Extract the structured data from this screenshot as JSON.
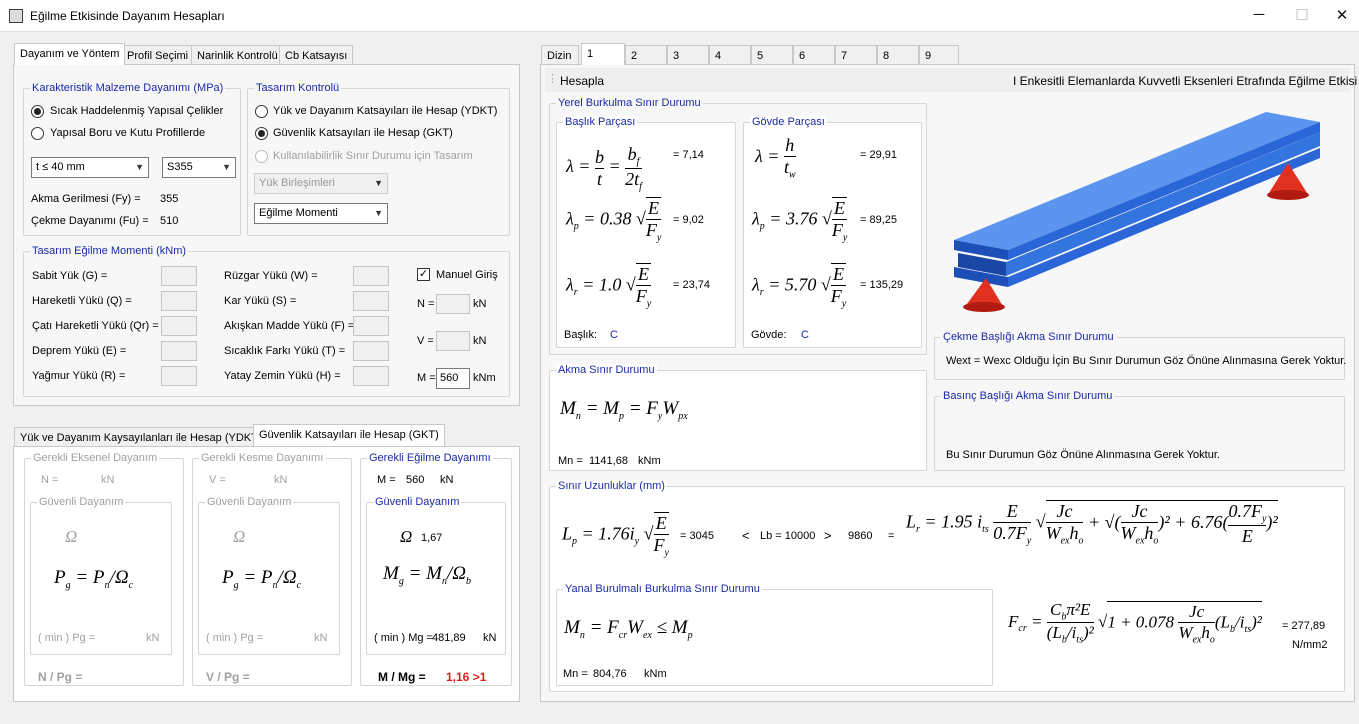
{
  "window": {
    "title": "Eğilme Etkisinde Dayanım Hesapları"
  },
  "left_tabs": [
    "Dayanım ve Yöntem",
    "Profil Seçimi",
    "Narinlik Kontrolü",
    "Cb Katsayısı"
  ],
  "material": {
    "legend": "Karakteristik Malzeme Dayanımı (MPa)",
    "opt1": "Sıcak Haddelenmiş Yapısal Çelikler",
    "opt2": "Yapısal Boru ve Kutu Profillerde",
    "thickness": "t ≤ 40 mm",
    "grade": "S355",
    "fy_label": "Akma Gerilmesi (Fy) =",
    "fy": "355",
    "fu_label": "Çekme Dayanımı (Fu) =",
    "fu": "510"
  },
  "design": {
    "legend": "Tasarım Kontrolü",
    "opt1": "Yük ve Dayanım Katsayıları ile Hesap (YDKT)",
    "opt2": "Güvenlik Katsayıları ile Hesap (GKT)",
    "opt3": "Kullanılabilirlik Sınır Durumu için Tasarım",
    "combo": "Yük Birleşimleri",
    "moment": "Eğilme Momenti"
  },
  "moments": {
    "legend": "Tasarım Eğilme Momenti (kNm)",
    "g": "Sabit Yük (G) =",
    "q": "Hareketli Yükü (Q) =",
    "qr": "Çatı Hareketli Yükü (Qr) =",
    "e": "Deprem Yükü (E) =",
    "r": "Yağmur Yükü (R) =",
    "w": "Rüzgar Yükü (W) =",
    "s": "Kar Yükü (S) =",
    "f": "Akışkan Madde Yükü (F) =",
    "t": "Sıcaklık Farkı Yükü (T) =",
    "h": "Yatay Zemin Yükü (H) =",
    "manual": "Manuel Giriş",
    "n_label": "N =",
    "v_label": "V =",
    "m_label": "M =",
    "unit_kn": "kN",
    "unit_knm": "kNm",
    "m_value": "560"
  },
  "result_tabs": [
    "Yük ve Dayanım Kaysayılanları ile Hesap (YDKT)",
    "Güvenlik Katsayıları ile Hesap (GKT)"
  ],
  "results": {
    "axial": {
      "legend": "Gerekli Eksenel Dayanım",
      "n_label": "N =",
      "unit": "kN",
      "sub": "Güvenli Dayanım",
      "omega": "Ω",
      "formula_l": "P",
      "formula_r": "P",
      "min_label": "( min ) Pg =",
      "ratio": "N / Pg ="
    },
    "shear": {
      "legend": "Gerekli Kesme Dayanımı",
      "v_label": "V =",
      "unit": "kN",
      "sub": "Güvenli Dayanım",
      "omega": "Ω",
      "min_label": "( min ) Pg =",
      "ratio": "V / Pg ="
    },
    "bending": {
      "legend": "Gerekli Eğilme Dayanımı",
      "m_label": "M =",
      "m_value": "560",
      "unit": "kN",
      "sub": "Güvenli Dayanım",
      "omega": "Ω",
      "omega_val": "1,67",
      "min_label": "( min ) Mg =",
      "mg": "481,89",
      "ratio": "M / Mg =",
      "ratio_val": "1,16 >1"
    }
  },
  "right_tabs": [
    "Dizin",
    "1",
    "2",
    "3",
    "4",
    "5",
    "6",
    "7",
    "8",
    "9"
  ],
  "toolbar": {
    "calc": "Hesapla",
    "heading": "I Enkesitli Elemanlarda Kuvvetli Eksenleri Etrafında Eğilme Etkisi"
  },
  "local": {
    "legend": "Yerel Burkulma Sınır Durumu",
    "flange": "Başlık Parçası",
    "web": "Gövde Parçası",
    "lf": "= 7,14",
    "lpf": "= 9,02",
    "lrf": "= 23,74",
    "lw": "= 29,91",
    "lpw": "= 89,25",
    "lrw": "= 135,29",
    "fclass_label": "Başlık:",
    "fclass": "C",
    "wclass_label": "Gövde:",
    "wclass": "C"
  },
  "yield": {
    "legend": "Akma Sınır Durumu",
    "mn_label": "Mn =",
    "mn": "1141,68",
    "unit": "kNm"
  },
  "tension_flange": {
    "legend": "Çekme Başlığı Akma Sınır Durumu",
    "text": "Wext = Wexc Olduğu İçin Bu Sınır Durumun Göz Önüne Alınmasına Gerek Yoktur."
  },
  "comp_flange": {
    "legend": "Basınç Başlığı Akma Sınır Durumu",
    "text": "Bu Sınır Durumun Göz Önüne Alınmasına Gerek Yoktur."
  },
  "lengths": {
    "legend": "Sınır Uzunluklar (mm)",
    "lp": "= 3045",
    "lt": "<",
    "lb": "Lb = 10000",
    "gt": ">",
    "lr": "9860",
    "eq": "="
  },
  "ltb": {
    "legend": "Yanal Burulmalı Burkulma Sınır Durumu",
    "mn_label": "Mn =",
    "mn": "804,76",
    "unit": "kNm",
    "fcr": "= 277,89",
    "fcr_unit": "N/mm2"
  },
  "colors": {
    "accent_blue": "#1a2aa8",
    "danger": "#e02020",
    "beam": "#2f6fd6",
    "support": "#e23020"
  }
}
